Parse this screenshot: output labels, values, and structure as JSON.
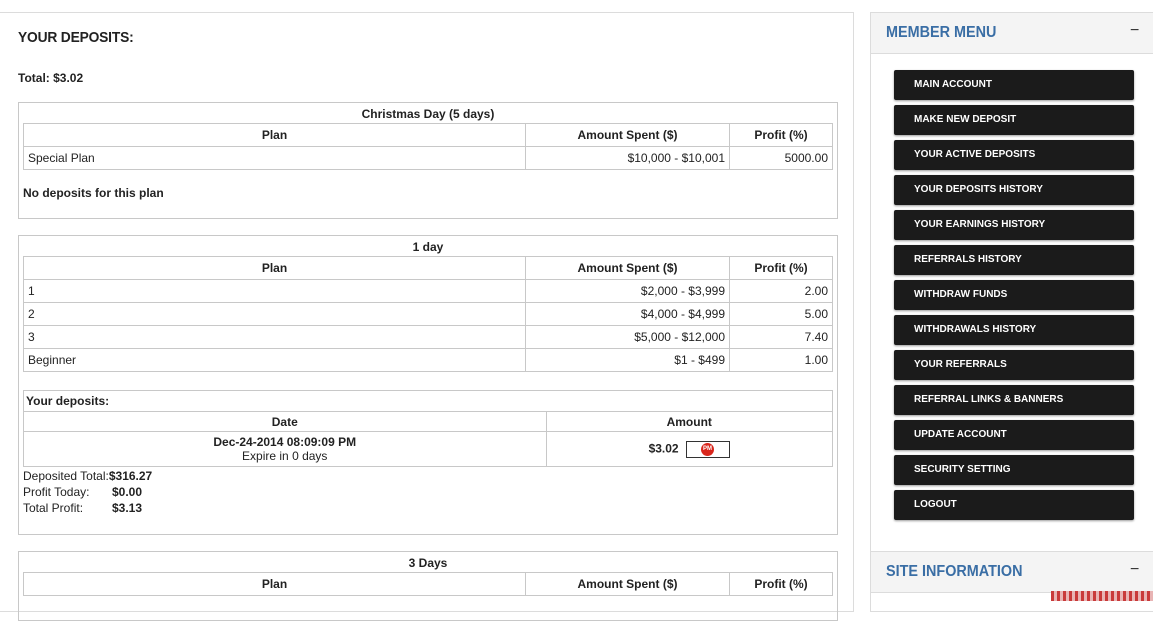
{
  "main": {
    "title": "YOUR DEPOSITS:",
    "total": "Total: $3.02"
  },
  "plans": [
    {
      "title": "Christmas Day (5 days)",
      "headers": [
        "Plan",
        "Amount Spent ($)",
        "Profit (%)"
      ],
      "rows": [
        {
          "name": "Special Plan",
          "amount": "$10,000 - $10,001",
          "profit": "5000.00"
        }
      ],
      "no_deposits": "No deposits for this plan"
    },
    {
      "title": "1 day",
      "headers": [
        "Plan",
        "Amount Spent ($)",
        "Profit (%)"
      ],
      "rows": [
        {
          "name": "1",
          "amount": "$2,000 - $3,999",
          "profit": "2.00"
        },
        {
          "name": "2",
          "amount": "$4,000 - $4,999",
          "profit": "5.00"
        },
        {
          "name": "3",
          "amount": "$5,000 - $12,000",
          "profit": "7.40"
        },
        {
          "name": "Beginner",
          "amount": "$1 - $499",
          "profit": "1.00"
        }
      ],
      "deposits": {
        "title": "Your deposits:",
        "headers": [
          "Date",
          "Amount"
        ],
        "entries": [
          {
            "date": "Dec-24-2014 08:09:09 PM",
            "expire": "Expire in 0 days",
            "amount": "$3.02",
            "processor_icon": "perfect-money-icon",
            "processor_text": "PM"
          }
        ]
      },
      "summary": [
        {
          "label": "Deposited Total:",
          "value": "$316.27"
        },
        {
          "label": "Profit Today:",
          "value": "$0.00"
        },
        {
          "label": "Total Profit:",
          "value": "$3.13"
        }
      ]
    },
    {
      "title": "3 Days",
      "headers": [
        "Plan",
        "Amount Spent ($)",
        "Profit (%)"
      ]
    }
  ],
  "sidebar": {
    "member_menu": {
      "title": "MEMBER MENU",
      "toggle": "−",
      "items": [
        "MAIN ACCOUNT",
        "MAKE NEW DEPOSIT",
        "YOUR ACTIVE DEPOSITS",
        "YOUR DEPOSITS HISTORY",
        "YOUR EARNINGS HISTORY",
        "REFERRALS HISTORY",
        "WITHDRAW FUNDS",
        "WITHDRAWALS HISTORY",
        "YOUR REFERRALS",
        "REFERRAL LINKS & BANNERS",
        "UPDATE ACCOUNT",
        "SECURITY SETTING",
        "LOGOUT"
      ]
    },
    "site_information": {
      "title": "SITE INFORMATION",
      "toggle": "−"
    }
  },
  "colors": {
    "sidebar_heading": "#3a6ea5",
    "menu_button": "#1b1b1b",
    "pm_icon": "#d9261c"
  }
}
